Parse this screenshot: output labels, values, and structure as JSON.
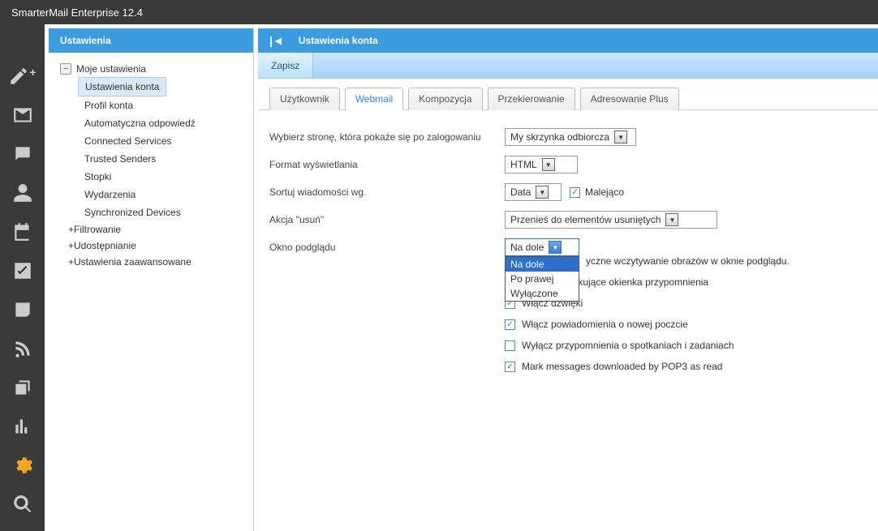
{
  "app_title": "SmarterMail Enterprise 12.4",
  "left_panel": {
    "title": "Ustawienia",
    "root": {
      "label": "Moje ustawienia",
      "children": [
        "Ustawienia konta",
        "Profil konta",
        "Automatyczna odpowiedź",
        "Connected Services",
        "Trusted Senders",
        "Stopki",
        "Wydarzenia",
        "Synchronized Devices"
      ]
    },
    "sub_nodes": [
      "Filtrowanie",
      "Udostępnianie",
      "Ustawienia zaawansowane"
    ]
  },
  "right_panel": {
    "title": "Ustawienia konta",
    "toolbar": {
      "save": "Zapisz"
    },
    "tabs": [
      "Użytkownik",
      "Webmail",
      "Kompozycja",
      "Przekierowanie",
      "Adresowanie Plus"
    ],
    "active_tab_index": 1,
    "form": {
      "login_page": {
        "label": "Wybierz stronę, która pokaże się po zalogowaniu",
        "value": "My skrzynka odbiorcza"
      },
      "display_format": {
        "label": "Format wyświetlania",
        "value": "HTML"
      },
      "sort_by": {
        "label": "Sortuj wiadomości wg.",
        "value": "Data",
        "desc_label": "Malejąco",
        "desc_checked": true
      },
      "delete_action": {
        "label": "Akcja \"usuń\"",
        "value": "Przenieś do elementów usuniętych"
      },
      "preview": {
        "label": "Okno podglądu",
        "value": "Na dole",
        "options": [
          "Na dole",
          "Po prawej",
          "Wyłączone"
        ]
      },
      "checkboxes": [
        {
          "checked": true,
          "label_tail": "yczne wczytywanie obrazów w oknie podglądu."
        },
        {
          "checked": true,
          "label_tail": "kakujące okienka przypomnienia",
          "partial_prefix": "Włącz wys"
        },
        {
          "checked": true,
          "label": "Włącz dźwięki"
        },
        {
          "checked": true,
          "label": "Włącz powiadomienia o nowej poczcie"
        },
        {
          "checked": false,
          "label": "Wyłącz przypomnienia o spotkaniach i zadaniach"
        },
        {
          "checked": true,
          "label": "Mark messages downloaded by POP3 as read"
        }
      ]
    }
  }
}
